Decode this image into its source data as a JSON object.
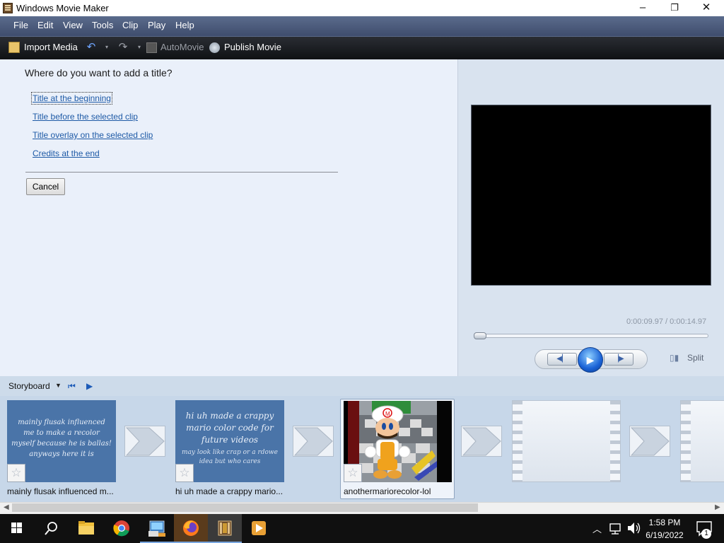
{
  "window": {
    "title": "Windows Movie Maker",
    "minimize": "–",
    "restore": "❐",
    "close": "✕"
  },
  "menu": [
    "File",
    "Edit",
    "View",
    "Tools",
    "Clip",
    "Play",
    "Help"
  ],
  "toolbar": {
    "import_media": "Import Media",
    "automovie": "AutoMovie",
    "publish_movie": "Publish Movie"
  },
  "title_pane": {
    "question": "Where do you want to add a title?",
    "options": [
      "Title at the beginning",
      "Title before the selected clip",
      "Title overlay on the selected clip",
      "Credits at the end"
    ],
    "cancel": "Cancel"
  },
  "preview": {
    "timecode": "0:00:09.97 / 0:00:14.97",
    "split": "Split",
    "position_fraction": 0.0
  },
  "storyboard": {
    "label": "Storyboard",
    "clips": [
      {
        "thumb_text": "mainly flusak influenced me to make a recolor myself because he is ballas! anyways here it is",
        "caption": "mainly flusak influenced m..."
      },
      {
        "thumb_text": "hi uh made a crappy mario color code for future videos",
        "thumb_subtext": "may look like crap or a rdowe idea but who cares",
        "caption": "hi uh made a crappy mario..."
      },
      {
        "caption": "anothermariorecolor-lol",
        "selected": true
      }
    ]
  },
  "taskbar": {
    "time": "1:58 PM",
    "date": "6/19/2022",
    "notifications": "1"
  },
  "colors": {
    "menubar": "#4a5a7a",
    "link": "#1e5aa6",
    "title_clip": "#4a74a8",
    "play": "#1a62d6"
  }
}
